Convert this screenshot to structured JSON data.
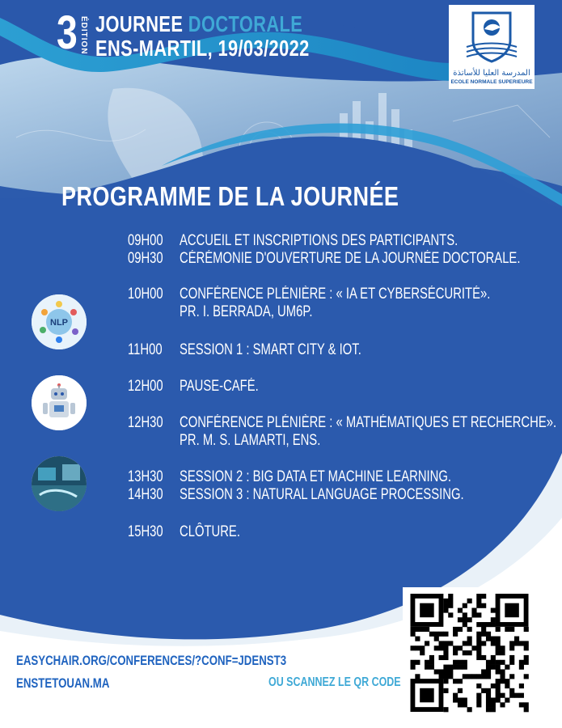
{
  "header": {
    "edition_number": "3",
    "edition_label": "ÉDITION",
    "title_line1_white": "JOURNEE",
    "title_line1_accent": "DOCTORALE",
    "title_line2": "ENS-MARTIL, 19/03/2022"
  },
  "logo": {
    "arabic_text": "المدرسة العليا للأساتذة",
    "caption": "ECOLE NORMALE SUPERIEURE"
  },
  "program_title": "PROGRAMME DE LA JOURNÉE",
  "schedule": [
    {
      "time": "09H00",
      "lines": [
        "ACCUEIL ET INSCRIPTIONS DES PARTICIPANTS."
      ]
    },
    {
      "time": "09H30",
      "lines": [
        "CÉRÉMONIE D'OUVERTURE DE LA JOURNÉE DOCTORALE."
      ]
    },
    {
      "time": "10H00",
      "lines": [
        "CONFÉRENCE PLÉNIÈRE : « IA ET CYBERSÉCURITÉ».",
        "PR. I. BERRADA, UM6P."
      ]
    },
    {
      "time": "11H00",
      "lines": [
        "SESSION 1 : SMART CITY & IOT."
      ]
    },
    {
      "time": "12H00",
      "lines": [
        "PAUSE-CAFÉ."
      ]
    },
    {
      "time": "12H30",
      "lines": [
        "CONFÉRENCE PLÉNIÈRE : « MATHÉMATIQUES ET RECHERCHE».",
        "PR. M. S. LAMARTI, ENS."
      ]
    },
    {
      "time": "13H30",
      "lines": [
        "SESSION 2 : BIG DATA ET MACHINE LEARNING."
      ]
    },
    {
      "time": "14H30",
      "lines": [
        "SESSION 3 : NATURAL LANGUAGE PROCESSING."
      ]
    },
    {
      "time": "15H30",
      "lines": [
        "CLÔTURE."
      ]
    }
  ],
  "images": {
    "nlp_label": "NLP"
  },
  "footer": {
    "url_conference": "EASYCHAIR.ORG/CONFERENCES/?CONF=JDENST3",
    "url_site": "ENSTETOUAN.MA",
    "qr_prompt": "OU SCANNEZ LE QR CODE"
  },
  "colors": {
    "background_blue": "#2a58ab",
    "accent_cyan": "#3fa9d6",
    "link_blue": "#1f63bf"
  }
}
